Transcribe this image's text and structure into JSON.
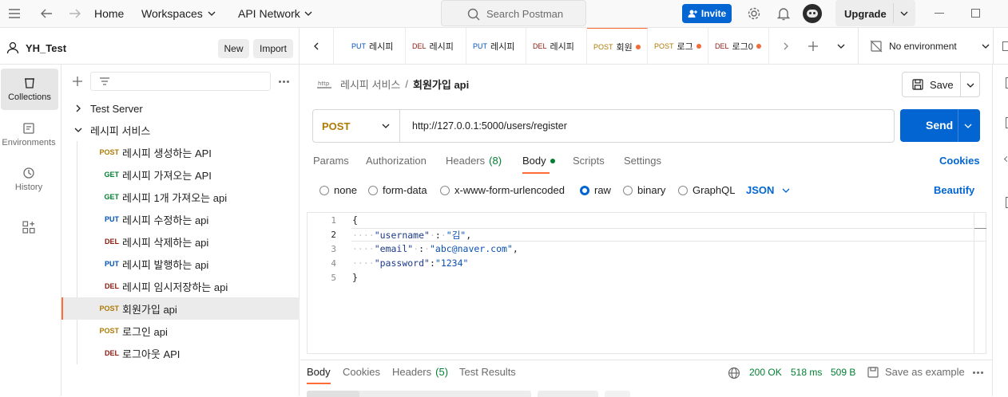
{
  "topbar": {
    "home": "Home",
    "workspaces": "Workspaces",
    "api_network": "API Network",
    "search_placeholder": "Search Postman",
    "invite": "Invite",
    "upgrade": "Upgrade"
  },
  "workspace": {
    "name": "YH_Test",
    "new_label": "New",
    "import_label": "Import"
  },
  "rail": [
    {
      "label": "Collections",
      "icon": "collections-icon"
    },
    {
      "label": "Environments",
      "icon": "environments-icon"
    },
    {
      "label": "History",
      "icon": "history-icon"
    }
  ],
  "tree": {
    "collections": [
      {
        "name": "Test Server"
      },
      {
        "name": "레시피 서비스"
      }
    ],
    "requests": [
      {
        "method": "POST",
        "name": "레시피 생성하는 API"
      },
      {
        "method": "GET",
        "name": "레시피 가져오는 API"
      },
      {
        "method": "GET",
        "name": "레시피 1개 가져오는 api"
      },
      {
        "method": "PUT",
        "name": "레시피 수정하는 api"
      },
      {
        "method": "DEL",
        "name": "레시피 삭제하는 api"
      },
      {
        "method": "PUT",
        "name": "레시피 발행하는 api"
      },
      {
        "method": "DEL",
        "name": "레시피 임시저장하는 api"
      },
      {
        "method": "POST",
        "name": "회원가입 api"
      },
      {
        "method": "POST",
        "name": "로그인 api"
      },
      {
        "method": "DEL",
        "name": "로그아웃 API"
      }
    ]
  },
  "tabs": [
    {
      "method": "PUT",
      "name": "레시피"
    },
    {
      "method": "DEL",
      "name": "레시피"
    },
    {
      "method": "PUT",
      "name": "레시피"
    },
    {
      "method": "DEL",
      "name": "레시피"
    },
    {
      "method": "POST",
      "name": "회원"
    },
    {
      "method": "POST",
      "name": "로그"
    },
    {
      "method": "DEL",
      "name": "로그0"
    }
  ],
  "environment": "No environment",
  "request": {
    "breadcrumb_parent": "레시피 서비스",
    "separator": "/",
    "title": "회원가입 api",
    "save": "Save",
    "method": "POST",
    "url": "http://127.0.0.1:5000/users/register",
    "send": "Send"
  },
  "subtabs": {
    "params": "Params",
    "authorization": "Authorization",
    "headers": "Headers",
    "headers_count": "(8)",
    "body": "Body",
    "scripts": "Scripts",
    "settings": "Settings",
    "cookies": "Cookies"
  },
  "body_types": {
    "none": "none",
    "form_data": "form-data",
    "urlencoded": "x-www-form-urlencoded",
    "raw": "raw",
    "binary": "binary",
    "graphql": "GraphQL",
    "json": "JSON",
    "beautify": "Beautify"
  },
  "code": {
    "l1": "{",
    "l2_key": "\"username\"",
    "l2_val": "\"김\"",
    "l3_key": "\"email\"",
    "l3_val": "\"abc@naver.com\"",
    "l4_key": "\"password\"",
    "l4_val": "\"1234\"",
    "l5": "}"
  },
  "response": {
    "body": "Body",
    "cookies": "Cookies",
    "headers": "Headers",
    "headers_count": "(5)",
    "test_results": "Test Results",
    "status": "200 OK",
    "time": "518 ms",
    "size": "509 B",
    "save_example": "Save as example"
  },
  "colors": {
    "accent_blue": "#0265d2",
    "post": "#ad7a03",
    "get": "#007f31",
    "put": "#0053b8",
    "del": "#8e1a10",
    "unsaved_dot": "#f26b3a",
    "ok_green": "#007f31"
  }
}
